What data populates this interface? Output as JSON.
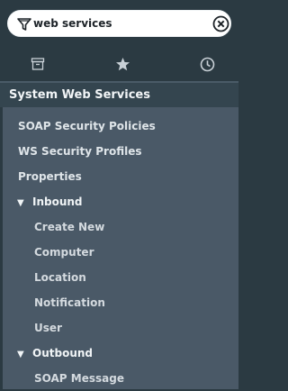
{
  "search": {
    "value": "web services",
    "placeholder": ""
  },
  "tabs": [
    {
      "name": "archive-icon",
      "active": false
    },
    {
      "name": "star-icon",
      "active": true
    },
    {
      "name": "clock-icon",
      "active": false
    }
  ],
  "tree": {
    "root": "System Web Services",
    "items": [
      {
        "label": "SOAP Security Policies"
      },
      {
        "label": "WS Security Profiles"
      },
      {
        "label": "Properties"
      }
    ],
    "inbound": {
      "label": "Inbound",
      "children": [
        "Create New",
        "Computer",
        "Location",
        "Notification",
        "User"
      ]
    },
    "outbound": {
      "label": "Outbound",
      "children": [
        "SOAP Message"
      ]
    }
  },
  "colors": {
    "background": "#2b3a42",
    "subtree": "#4a5967",
    "root_row": "#34454f"
  }
}
